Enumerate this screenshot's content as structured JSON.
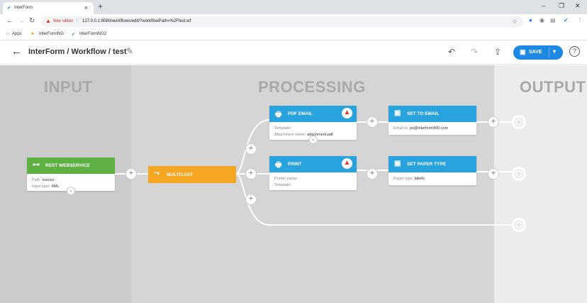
{
  "browser": {
    "tab_title": "InterForm",
    "tab_close": "×",
    "new_tab": "+",
    "window_controls": [
      "–",
      "❐",
      "✕"
    ],
    "insecure_label": "Ikke sikker",
    "url": "127.0.0.1:8080/workflows/edit/?workflowPath=%2Ftest.wf",
    "bookmarks": [
      "Apps",
      "InterFormNG",
      "InterFormNG2"
    ]
  },
  "header": {
    "back_icon": "←",
    "title": "InterForm / Workflow / test",
    "edit_icon": "✎",
    "undo_icon": "↶",
    "redo_icon": "↷",
    "upload_icon": "⇪",
    "save_label": "SAVE",
    "save_icon": "💾",
    "save_dropdown_icon": "▾",
    "help_icon": "?"
  },
  "lanes": {
    "input": "INPUT",
    "processing": "PROCESSING",
    "output": "OUTPUT"
  },
  "colors": {
    "input_card": "#5fb043",
    "processing_card": "#29a3dd",
    "multicast": "#f5a623",
    "warning": "#e53935",
    "save_button": "#1e88e5"
  },
  "nodes": {
    "rest": {
      "title": "REST WEBSERVICE",
      "icon": "⊶",
      "path_label": "Path:",
      "path_value": "invoice",
      "input_type_label": "Input type:",
      "input_type_value": "XML"
    },
    "multicast": {
      "title": "MULTICAST",
      "icon": "⤳"
    },
    "pdf_email": {
      "title": "PDF EMAIL",
      "icon": "🖶",
      "template_label": "Template:",
      "attachment_label": "Attachment name:",
      "attachment_value": "attachment.pdf",
      "warning_icon": "▲"
    },
    "print": {
      "title": "PRINT",
      "icon": "🖶",
      "printer_label": "Printer name:",
      "template_label": "Template:",
      "warning_icon": "▲"
    },
    "set_to_email": {
      "title": "SET TO EMAIL",
      "icon": "▣",
      "email_label": "Email to:",
      "email_value": "ps@interform400.com"
    },
    "set_paper_type": {
      "title": "SET PAPER TYPE",
      "icon": "▣",
      "paper_label": "Paper type:",
      "paper_value": "labels"
    }
  },
  "connector_plus": "+",
  "chevron": "⌄"
}
